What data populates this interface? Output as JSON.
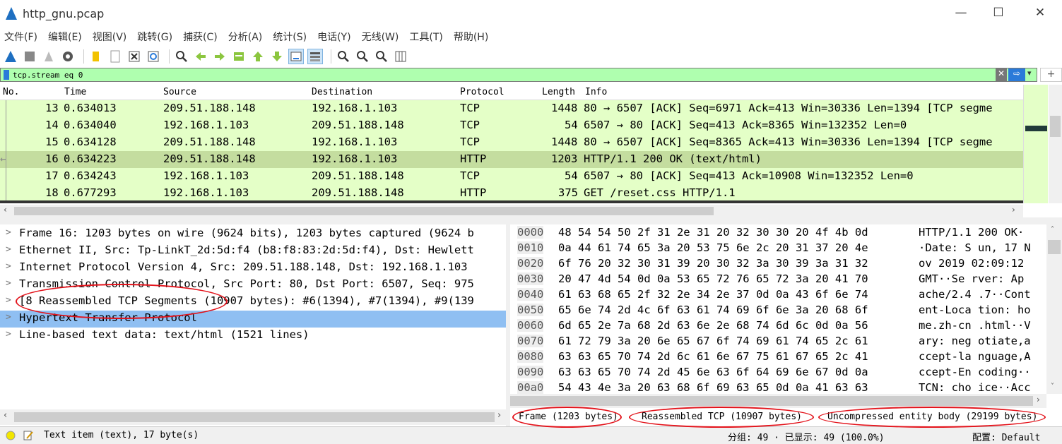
{
  "window": {
    "title": "http_gnu.pcap",
    "minimize": "—",
    "maximize": "☐",
    "close": "✕"
  },
  "menu": [
    "文件(F)",
    "编辑(E)",
    "视图(V)",
    "跳转(G)",
    "捕获(C)",
    "分析(A)",
    "统计(S)",
    "电话(Y)",
    "无线(W)",
    "工具(T)",
    "帮助(H)"
  ],
  "toolbar_icons": [
    "shark-fin-icon",
    "stop-icon",
    "restart-icon",
    "options-gear-icon",
    "open-folder-icon",
    "file-icon",
    "close-file-icon",
    "reload-icon",
    "find-icon",
    "go-back-icon",
    "go-forward-icon",
    "go-to-packet-icon",
    "first-packet-icon",
    "last-packet-icon",
    "autoscroll-icon",
    "colorize-icon",
    "zoom-in-icon",
    "zoom-out-icon",
    "normal-size-icon",
    "resize-columns-icon"
  ],
  "filter": {
    "value": "tcp.stream eq 0",
    "clear": "✕",
    "apply": "⇨",
    "dropdown": "▾"
  },
  "packet_list": {
    "headers": [
      "No.",
      "Time",
      "Source",
      "Destination",
      "Protocol",
      "Length",
      "Info"
    ],
    "rows": [
      {
        "no": "13",
        "time": "0.634013",
        "src": "209.51.188.148",
        "dst": "192.168.1.103",
        "proto": "TCP",
        "len": "1448",
        "info": "80 → 6507 [ACK] Seq=6971 Ack=413 Win=30336 Len=1394 [TCP segme"
      },
      {
        "no": "14",
        "time": "0.634040",
        "src": "192.168.1.103",
        "dst": "209.51.188.148",
        "proto": "TCP",
        "len": "54",
        "info": "6507 → 80 [ACK] Seq=413 Ack=8365 Win=132352 Len=0"
      },
      {
        "no": "15",
        "time": "0.634128",
        "src": "209.51.188.148",
        "dst": "192.168.1.103",
        "proto": "TCP",
        "len": "1448",
        "info": "80 → 6507 [ACK] Seq=8365 Ack=413 Win=30336 Len=1394 [TCP segme"
      },
      {
        "no": "16",
        "time": "0.634223",
        "src": "209.51.188.148",
        "dst": "192.168.1.103",
        "proto": "HTTP",
        "len": "1203",
        "info": "HTTP/1.1 200 OK  (text/html)"
      },
      {
        "no": "17",
        "time": "0.634243",
        "src": "192.168.1.103",
        "dst": "209.51.188.148",
        "proto": "TCP",
        "len": "54",
        "info": "6507 → 80 [ACK] Seq=413 Ack=10908 Win=132352 Len=0"
      },
      {
        "no": "18",
        "time": "0.677293",
        "src": "192.168.1.103",
        "dst": "209.51.188.148",
        "proto": "HTTP",
        "len": "375",
        "info": "GET /reset.css HTTP/1.1"
      }
    ]
  },
  "details": [
    "Frame 16: 1203 bytes on wire (9624 bits), 1203 bytes captured (9624 b",
    "Ethernet II, Src: Tp-LinkT_2d:5d:f4 (b8:f8:83:2d:5d:f4), Dst: Hewlett",
    "Internet Protocol Version 4, Src: 209.51.188.148, Dst: 192.168.1.103",
    "Transmission Control Protocol, Src Port: 80, Dst Port: 6507, Seq: 975",
    "[8 Reassembled TCP Segments (10907 bytes): #6(1394), #7(1394), #9(139",
    "Hypertext Transfer Protocol",
    "Line-based text data: text/html (1521 lines)"
  ],
  "bytes": [
    {
      "off": "0000",
      "hex": "48 54 54 50 2f 31 2e 31  20 32 30 30 20 4f 4b 0d",
      "asc": "HTTP/1.1  200 OK·"
    },
    {
      "off": "0010",
      "hex": "0a 44 61 74 65 3a 20 53  75 6e 2c 20 31 37 20 4e",
      "asc": "·Date: S un, 17 N"
    },
    {
      "off": "0020",
      "hex": "6f 76 20 32 30 31 39 20  30 32 3a 30 39 3a 31 32",
      "asc": "ov 2019  02:09:12"
    },
    {
      "off": "0030",
      "hex": "20 47 4d 54 0d 0a 53 65  72 76 65 72 3a 20 41 70",
      "asc": " GMT··Se rver: Ap"
    },
    {
      "off": "0040",
      "hex": "61 63 68 65 2f 32 2e 34  2e 37 0d 0a 43 6f 6e 74",
      "asc": "ache/2.4 .7··Cont"
    },
    {
      "off": "0050",
      "hex": "65 6e 74 2d 4c 6f 63 61  74 69 6f 6e 3a 20 68 6f",
      "asc": "ent-Loca tion: ho"
    },
    {
      "off": "0060",
      "hex": "6d 65 2e 7a 68 2d 63 6e  2e 68 74 6d 6c 0d 0a 56",
      "asc": "me.zh-cn .html··V"
    },
    {
      "off": "0070",
      "hex": "61 72 79 3a 20 6e 65 67  6f 74 69 61 74 65 2c 61",
      "asc": "ary: neg otiate,a"
    },
    {
      "off": "0080",
      "hex": "63 63 65 70 74 2d 6c 61  6e 67 75 61 67 65 2c 41",
      "asc": "ccept-la nguage,A"
    },
    {
      "off": "0090",
      "hex": "63 63 65 70 74 2d 45 6e  63 6f 64 69 6e 67 0d 0a",
      "asc": "ccept-En coding··"
    },
    {
      "off": "00a0",
      "hex": "54 43 4e 3a 20 63 68 6f  69 63 65 0d 0a 41 63 63",
      "asc": "TCN: cho ice··Acc"
    }
  ],
  "byte_tabs": [
    "Frame (1203 bytes)",
    "Reassembled TCP (10907 bytes)",
    "Uncompressed entity body (29199 bytes)"
  ],
  "status": {
    "text": "Text item (text), 17 byte(s)",
    "packets": "分组: 49 · 已显示: 49 (100.0%)",
    "profile": "配置: Default"
  },
  "colors": {
    "packet_bg": "#e4ffc7",
    "selected_row": "#c4dd9f",
    "detail_selected": "#8fbff2",
    "filter_bg": "#afffaf",
    "annotation": "#e3131b"
  }
}
